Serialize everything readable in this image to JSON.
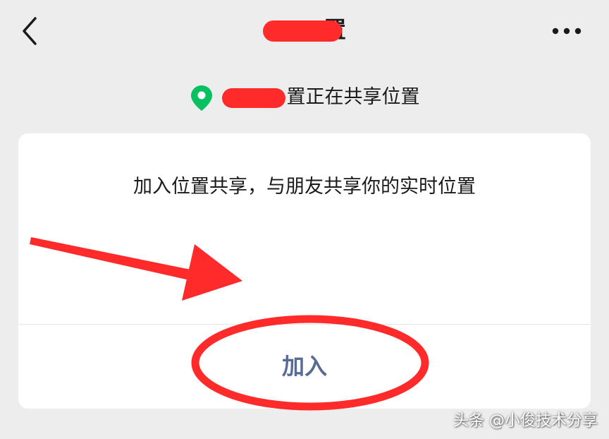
{
  "header": {
    "title_suffix": "置"
  },
  "status": {
    "text": "置正在共享位置",
    "icon": "location-pin-icon"
  },
  "card": {
    "message": "加入位置共享，与朋友共享你的实时位置",
    "join_label": "加入"
  },
  "watermark": "头条 @小俊技术分享",
  "colors": {
    "background": "#ededed",
    "card": "#ffffff",
    "link": "#576b95",
    "pin": "#07c160",
    "annotation": "#ff2a2a"
  }
}
